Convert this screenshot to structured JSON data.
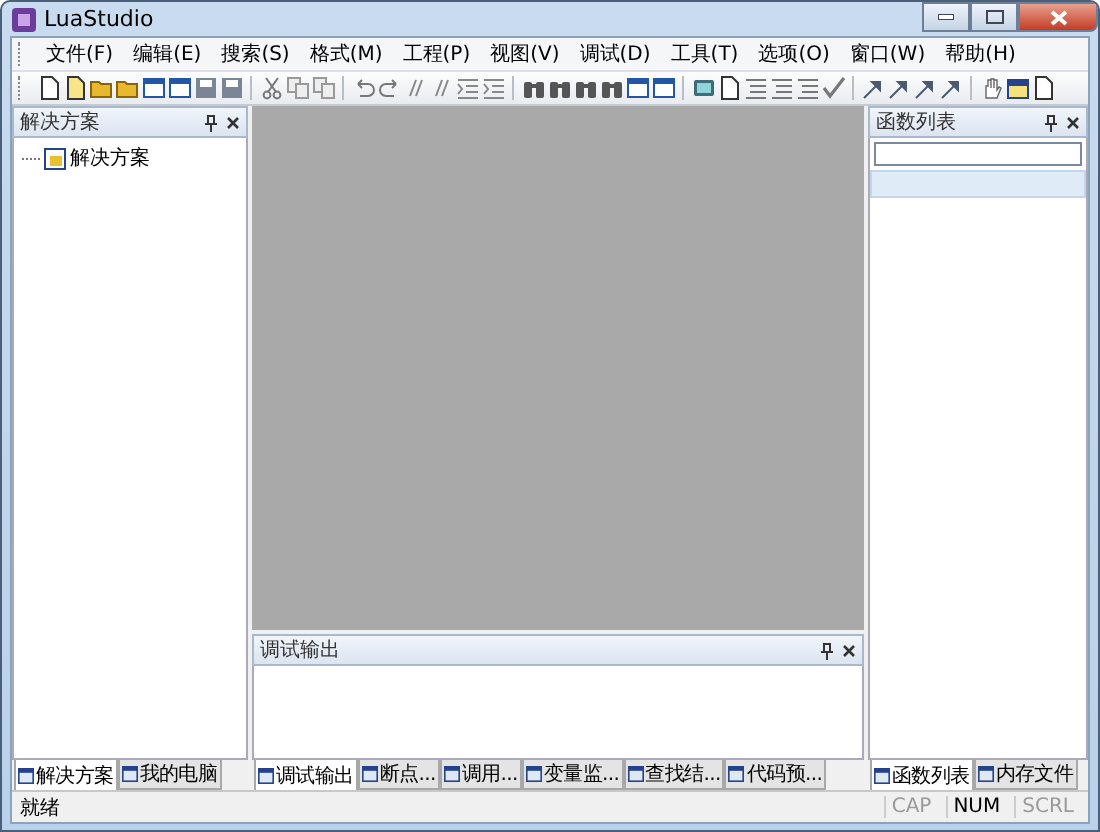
{
  "window": {
    "title": "LuaStudio"
  },
  "menu": [
    "文件(F)",
    "编辑(E)",
    "搜索(S)",
    "格式(M)",
    "工程(P)",
    "视图(V)",
    "调试(D)",
    "工具(T)",
    "选项(O)",
    "窗口(W)",
    "帮助(H)"
  ],
  "left_panel": {
    "title": "解决方案",
    "tree": [
      {
        "label": "解决方案"
      }
    ],
    "tabs": [
      {
        "label": "解决方案",
        "selected": true
      },
      {
        "label": "我的电脑",
        "selected": false
      }
    ]
  },
  "output_panel": {
    "title": "调试输出",
    "tabs": [
      {
        "label": "调试输出",
        "selected": true
      },
      {
        "label": "断点...",
        "selected": false
      },
      {
        "label": "调用...",
        "selected": false
      },
      {
        "label": "变量监...",
        "selected": false
      },
      {
        "label": "查找结...",
        "selected": false
      },
      {
        "label": "代码预...",
        "selected": false
      }
    ]
  },
  "right_panel": {
    "title": "函数列表",
    "tabs": [
      {
        "label": "函数列表",
        "selected": true
      },
      {
        "label": "内存文件",
        "selected": false
      }
    ]
  },
  "status_bar": {
    "text": "就绪",
    "indicators": [
      {
        "label": "CAP",
        "on": false
      },
      {
        "label": "NUM",
        "on": true
      },
      {
        "label": "SCRL",
        "on": false
      }
    ]
  }
}
